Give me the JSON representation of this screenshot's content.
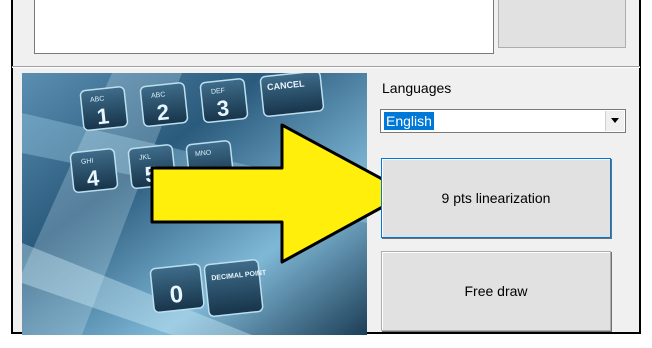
{
  "languages": {
    "label": "Languages",
    "selected": "English"
  },
  "buttons": {
    "linearization": "9 pts linearization",
    "free_draw": "Free draw"
  },
  "keypad_image": {
    "keys": [
      "1",
      "2",
      "3",
      "4",
      "5",
      "0"
    ],
    "key_captions": [
      "ABC",
      "DEF",
      "GHI",
      "JKL",
      "MNO",
      "CANCEL",
      "DECIMAL POINT"
    ]
  },
  "colors": {
    "arrow_fill": "#ffef0a",
    "arrow_stroke": "#000000",
    "selection": "#0078d7"
  }
}
